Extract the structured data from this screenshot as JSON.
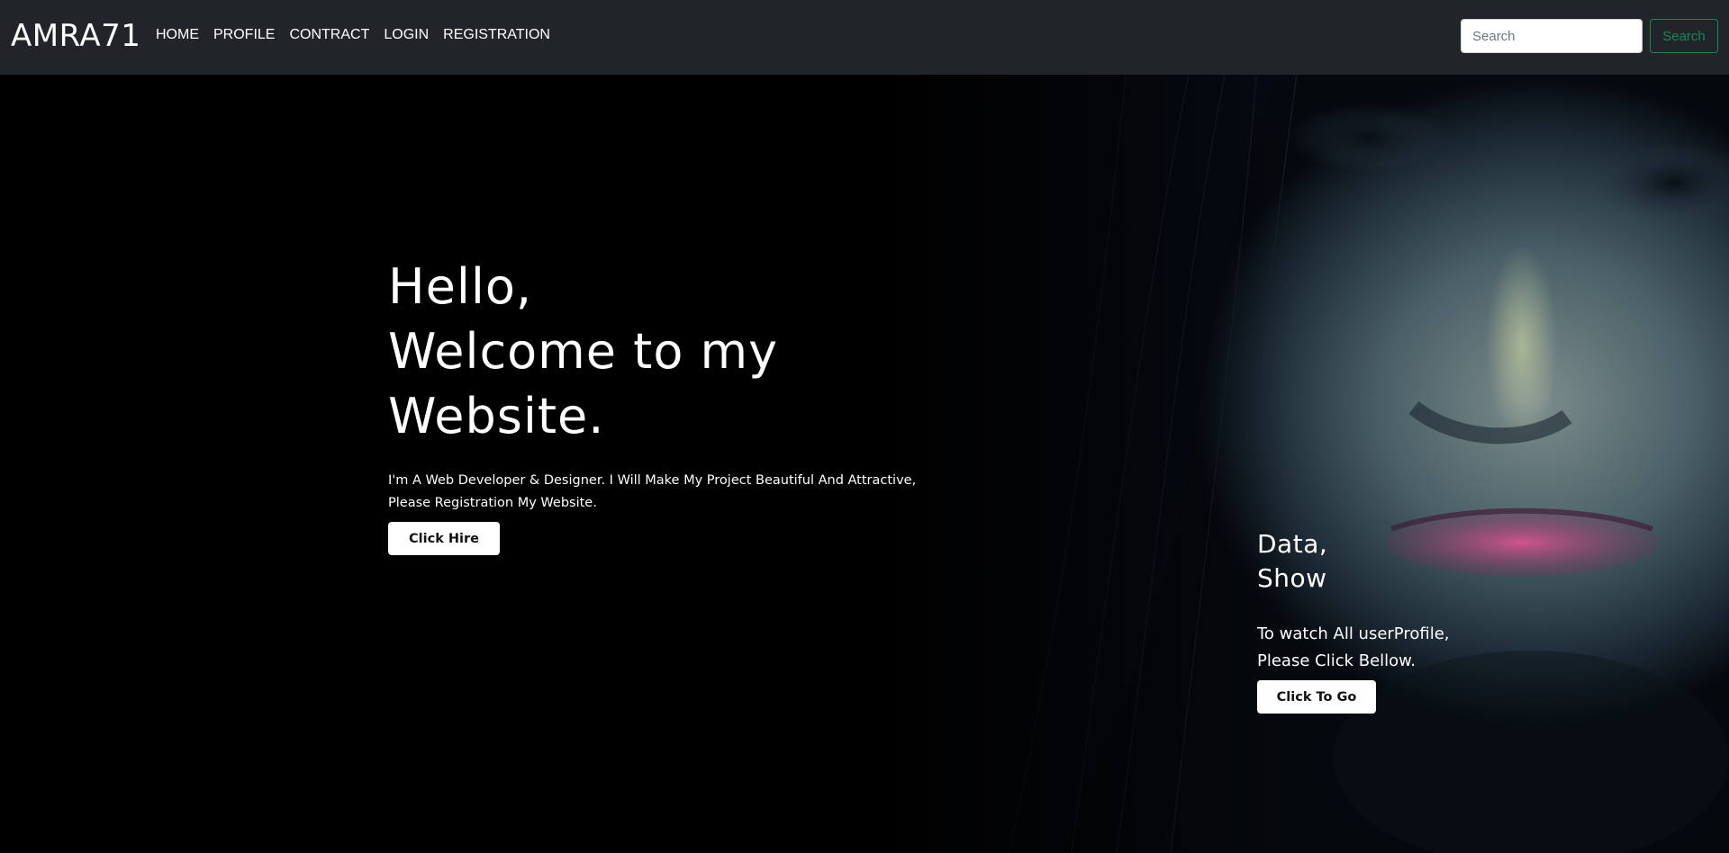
{
  "navbar": {
    "brand": "AMRA71",
    "links": [
      "HOME",
      "PROFILE",
      "CONTRACT",
      "LOGIN",
      "REGISTRATION"
    ],
    "search": {
      "placeholder": "Search",
      "button_label": "Search"
    }
  },
  "hero": {
    "title_lines": [
      "Hello,",
      "Welcome to my",
      "Website."
    ],
    "text_lines": [
      "I'm A Web Developer & Designer. I Will Make My Project Beautiful And Attractive,",
      "Please Registration My Website."
    ],
    "hire_button": "Click Hire",
    "image": "woman-face-portrait"
  },
  "side_panel": {
    "title_lines": [
      "Data,",
      "Show"
    ],
    "text_lines": [
      "To watch All userProfile,",
      "Please Click Bellow."
    ],
    "button": "Click To Go"
  },
  "colors": {
    "navbar_bg": "#212529",
    "hero_bg": "#000000",
    "search_outline": "#198754"
  }
}
